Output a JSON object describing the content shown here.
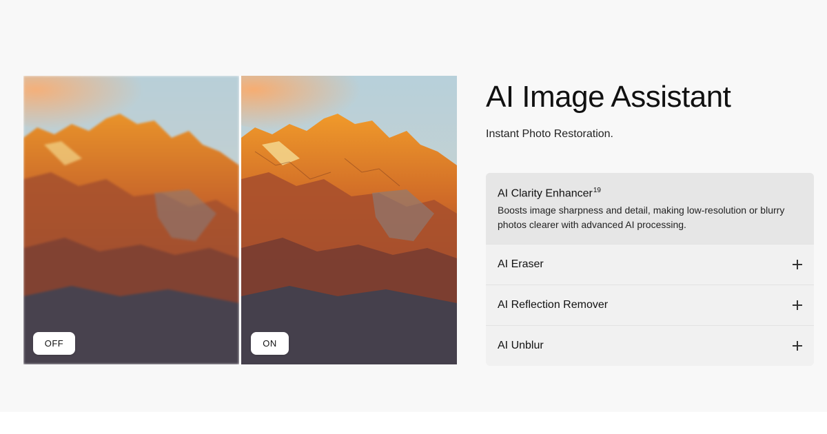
{
  "compare": {
    "off_label": "OFF",
    "on_label": "ON"
  },
  "header": {
    "title": "AI Image Assistant",
    "subtitle": "Instant Photo Restoration."
  },
  "features": {
    "active": {
      "label": "AI Clarity Enhancer",
      "footnote": "19",
      "description": "Boosts image sharpness and detail, making low-resolution or blurry photos clearer with advanced AI processing."
    },
    "items": [
      {
        "label": "AI Eraser"
      },
      {
        "label": "AI Reflection Remover"
      },
      {
        "label": "AI Unblur"
      }
    ],
    "expand_icon": "plus-icon"
  },
  "colors": {
    "background": "#f8f8f8",
    "accordion_bg": "#f1f1f1",
    "accordion_active_bg": "#e6e6e6",
    "text": "#111111"
  }
}
